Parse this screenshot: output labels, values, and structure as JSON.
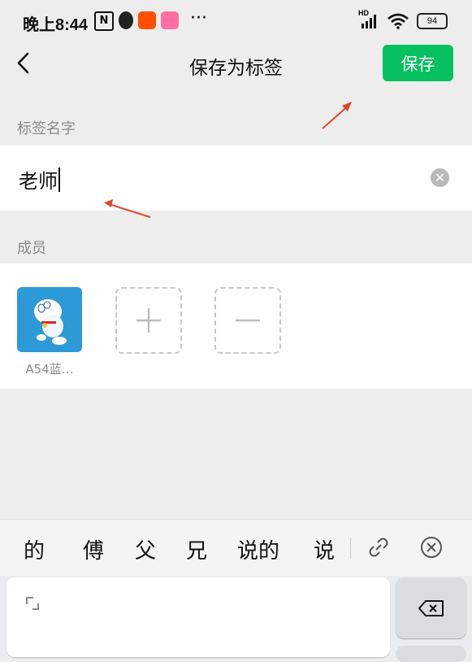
{
  "status_bar": {
    "time": "晚上8:44",
    "dots": "···",
    "battery": "94",
    "network": "HD"
  },
  "header": {
    "title": "保存为标签",
    "save_label": "保存"
  },
  "tag_name": {
    "section_label": "标签名字",
    "value": "老师"
  },
  "members": {
    "section_label": "成员",
    "items": [
      {
        "name": "A54蓝…"
      }
    ]
  },
  "ime": {
    "candidates": [
      "的",
      "傅",
      "父",
      "兄",
      "说的",
      "说"
    ]
  },
  "colors": {
    "accent": "#07c160",
    "background": "#ededed",
    "arrow": "#e2452d"
  }
}
